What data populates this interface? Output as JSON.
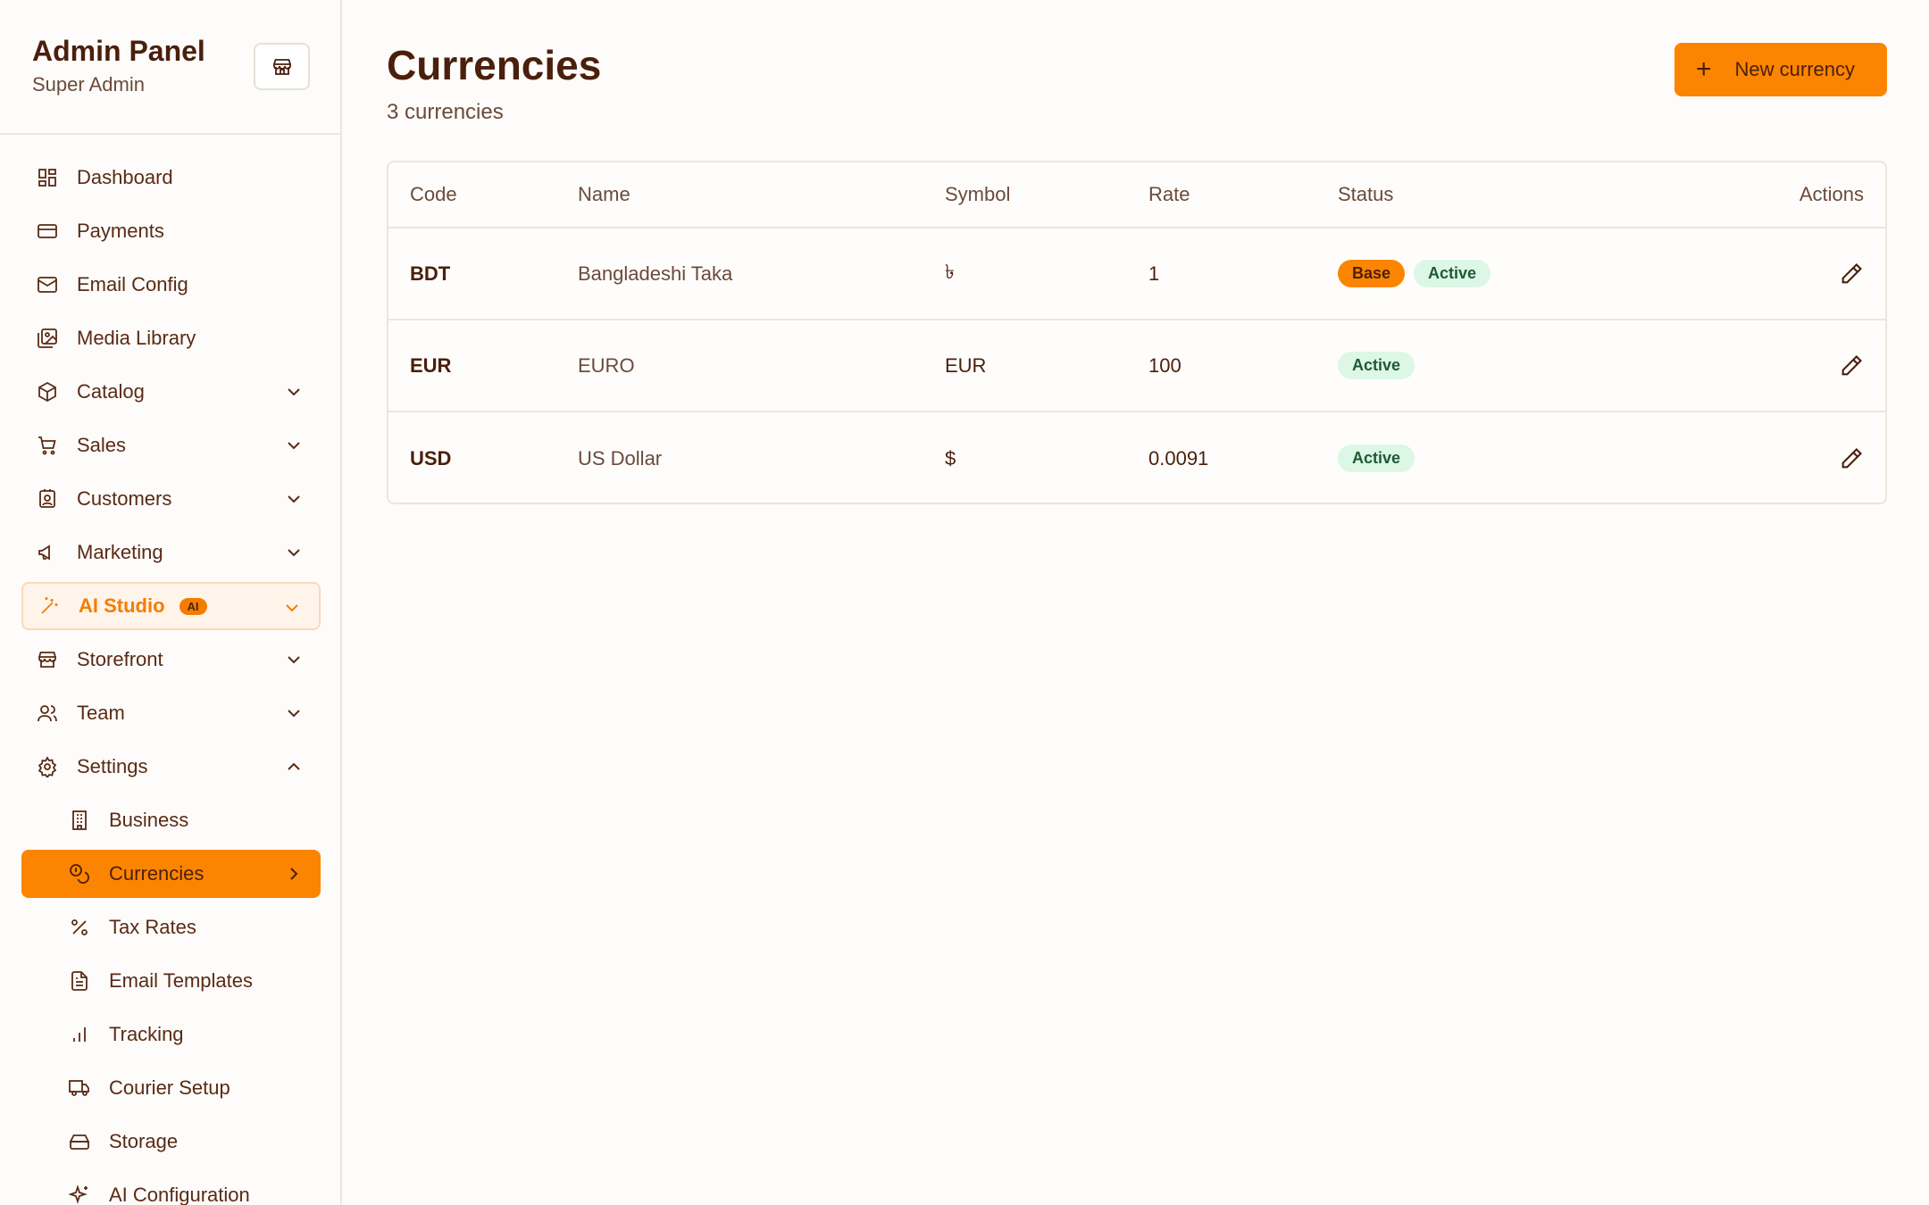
{
  "sidebar": {
    "title": "Admin Panel",
    "subtitle": "Super Admin",
    "items": [
      {
        "label": "Dashboard",
        "icon": "dashboard-icon"
      },
      {
        "label": "Payments",
        "icon": "credit-card-icon"
      },
      {
        "label": "Email Config",
        "icon": "mail-icon"
      },
      {
        "label": "Media Library",
        "icon": "image-library-icon"
      },
      {
        "label": "Catalog",
        "icon": "package-icon"
      },
      {
        "label": "Sales",
        "icon": "cart-icon"
      },
      {
        "label": "Customers",
        "icon": "contact-icon"
      },
      {
        "label": "Marketing",
        "icon": "megaphone-icon"
      },
      {
        "label": "AI Studio",
        "icon": "magic-wand-icon",
        "badge": "AI"
      },
      {
        "label": "Storefront",
        "icon": "store-icon"
      },
      {
        "label": "Team",
        "icon": "users-icon"
      },
      {
        "label": "Settings",
        "icon": "gear-icon"
      },
      {
        "label": "Business",
        "icon": "building-icon"
      },
      {
        "label": "Currencies",
        "icon": "coins-icon"
      },
      {
        "label": "Tax Rates",
        "icon": "percent-icon"
      },
      {
        "label": "Email Templates",
        "icon": "file-text-icon"
      },
      {
        "label": "Tracking",
        "icon": "bar-chart-icon"
      },
      {
        "label": "Courier Setup",
        "icon": "truck-icon"
      },
      {
        "label": "Storage",
        "icon": "hard-drive-icon"
      },
      {
        "label": "AI Configuration",
        "icon": "sparkles-icon"
      }
    ]
  },
  "header": {
    "title": "Currencies",
    "subtitle": "3 currencies",
    "new_button": "New currency"
  },
  "table": {
    "columns": {
      "code": "Code",
      "name": "Name",
      "symbol": "Symbol",
      "rate": "Rate",
      "status": "Status",
      "actions": "Actions"
    },
    "rows": [
      {
        "code": "BDT",
        "name": "Bangladeshi Taka",
        "symbol": "৳",
        "rate": "1",
        "base": "Base",
        "status": "Active"
      },
      {
        "code": "EUR",
        "name": "EURO",
        "symbol": "EUR",
        "rate": "100",
        "status": "Active"
      },
      {
        "code": "USD",
        "name": "US Dollar",
        "symbol": "$",
        "rate": "0.0091",
        "status": "Active"
      }
    ]
  },
  "colors": {
    "accent": "#fb8500",
    "text": "#4a1f0c",
    "active_badge_bg": "#dcf7e6"
  }
}
